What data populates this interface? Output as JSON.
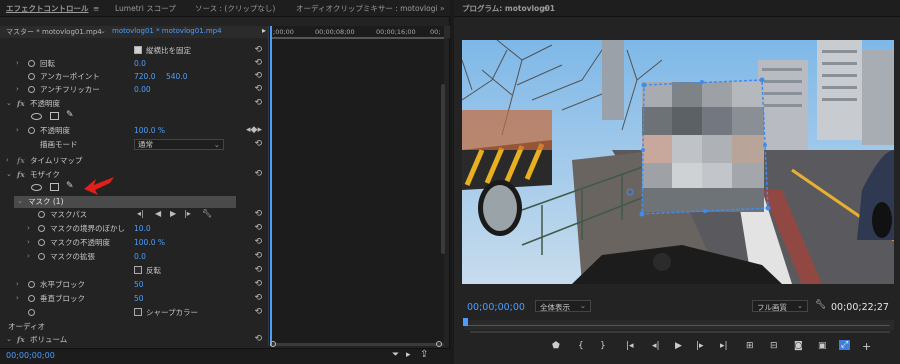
{
  "left_tabs": {
    "effect_controls": "エフェクトコントロール",
    "menu_glyph": "≡",
    "lumetri": "Lumetri スコープ",
    "source": "ソース : (クリップなし)",
    "audio_mixer": "オーディオクリップミキサー : motovlogi"
  },
  "program_tab": {
    "label": "プログラム: motovlog01",
    "menu_glyph": "≡"
  },
  "expand_glyph": "»",
  "clip_header": {
    "master": "マスター * motovlog01.mp4",
    "sequence": "motovlog01 * motovlog01.mp4"
  },
  "timeline": {
    "t0": ";00;00",
    "t1": "00;00;08;00",
    "t2": "00;00;16;00",
    "t3": "00;"
  },
  "properties": {
    "uniform_scale": "縦横比を固定",
    "rotation": "回転",
    "rotation_val": "0.0",
    "anchor": "アンカーポイント",
    "anchor_x": "720.0",
    "anchor_y": "540.0",
    "antiflicker": "アンチフリッカー",
    "antiflicker_val": "0.00",
    "opacity_section": "不透明度",
    "opacity": "不透明度",
    "opacity_val": "100.0 %",
    "blend_mode": "描画モード",
    "blend_val": "通常",
    "time_remap": "タイムリマップ",
    "mosaic": "モザイク",
    "mask": "マスク (1)",
    "mask_path": "マスクパス",
    "mask_feather": "マスクの境界のぼかし",
    "mask_feather_val": "10.0",
    "mask_opacity": "マスクの不透明度",
    "mask_opacity_val": "100.0 %",
    "mask_expansion": "マスクの拡張",
    "mask_expansion_val": "0.0",
    "invert": "反転",
    "h_blocks": "水平ブロック",
    "h_blocks_val": "50",
    "v_blocks": "垂直ブロック",
    "v_blocks_val": "50",
    "sharp_colors": "シャープカラー",
    "audio": "オーディオ",
    "volume": "ボリューム",
    "fx": "fx"
  },
  "bottom_left": {
    "timecode": "00;00;00;00"
  },
  "program": {
    "timecode": "00;00;00;00",
    "fit": "全体表示",
    "quality": "フル画質",
    "duration": "00;00;22;27"
  },
  "colors": {
    "accent": "#4a9eff",
    "arrow": "#e0201a",
    "bg": "#1a1a1a",
    "panel": "#232323"
  }
}
